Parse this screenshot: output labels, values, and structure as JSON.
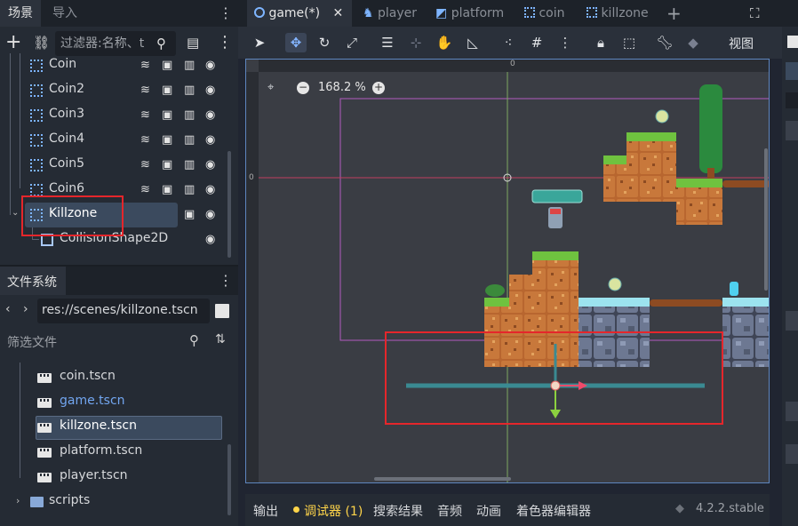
{
  "scene_dock": {
    "tabs": [
      "场景",
      "导入"
    ],
    "filter_placeholder": "过滤器:名称、t",
    "nodes": [
      "Coin",
      "Coin2",
      "Coin3",
      "Coin4",
      "Coin5",
      "Coin6",
      "Killzone",
      "CollisionShape2D"
    ]
  },
  "filesystem": {
    "title": "文件系统",
    "path": "res://scenes/killzone.tscn",
    "filter_placeholder": "筛选文件",
    "files": [
      "coin.tscn",
      "game.tscn",
      "killzone.tscn",
      "platform.tscn",
      "player.tscn"
    ],
    "folder": "scripts"
  },
  "doc_tabs": [
    "game(*)",
    "player",
    "platform",
    "coin",
    "killzone"
  ],
  "toolbar": {
    "view_label": "视图"
  },
  "viewport": {
    "zoom": "168.2 %",
    "ruler_zero_h": "0",
    "ruler_zero_v": "0"
  },
  "bottom_panel": {
    "tabs": [
      "输出",
      "调试器 (1)",
      "搜索结果",
      "音频",
      "动画",
      "着色器编辑器"
    ],
    "version": "4.2.2.stable"
  },
  "colors": {
    "accent": "#5e86bf",
    "highlight": "#e5262b",
    "selected_row": "#3b4a5e"
  }
}
